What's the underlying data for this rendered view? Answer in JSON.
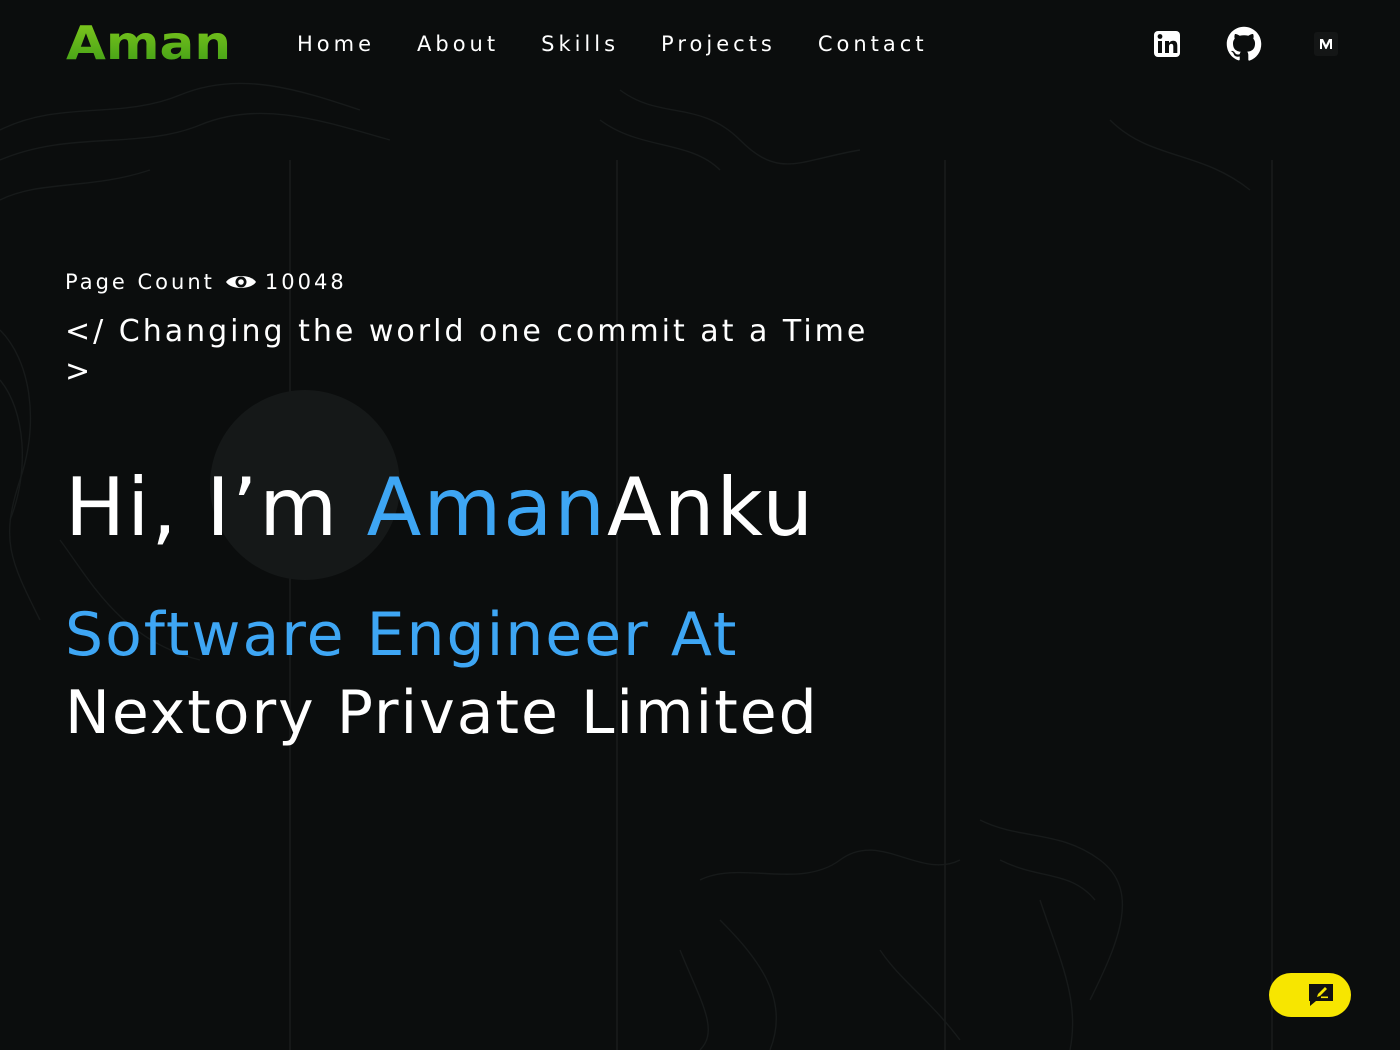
{
  "header": {
    "logo_text": "Aman",
    "logo_colors": [
      "#7fc41c",
      "#3a9a18"
    ],
    "nav": [
      {
        "label": "Home"
      },
      {
        "label": "About"
      },
      {
        "label": "Skills"
      },
      {
        "label": "Projects"
      },
      {
        "label": "Contact"
      }
    ],
    "social_icons": [
      "linkedin-icon",
      "github-icon",
      "medium-icon"
    ]
  },
  "hero": {
    "page_count_label": "Page Count",
    "page_count_value": "10048",
    "tagline": "</ Changing the world one commit at a Time >",
    "greeting": "Hi, I’m ",
    "first_name": "Aman",
    "last_name": "Anku",
    "role_line1": "Software Engineer At",
    "role_line2": "Nextory Private Limited"
  },
  "chat_button": {
    "icon": "chat-icon",
    "color": "#f7e600"
  },
  "colors": {
    "background": "#0b0d0d",
    "accent": "#3ea6f4",
    "text": "#ffffff"
  }
}
